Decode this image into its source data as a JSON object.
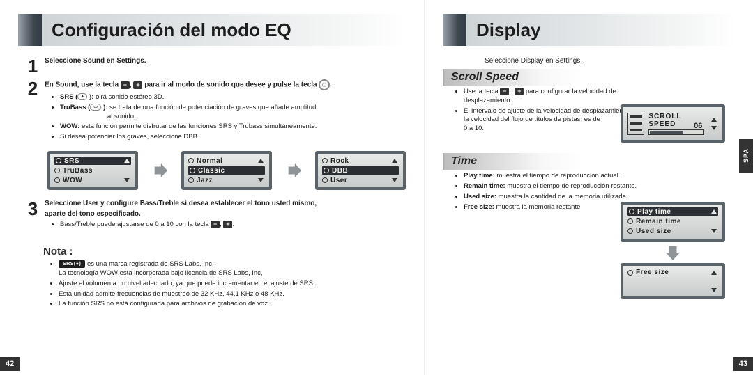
{
  "left": {
    "title": "Configuración del modo EQ",
    "page_number": "42",
    "step1": {
      "num": "1",
      "head": "Seleccione Sound en Settings."
    },
    "step2": {
      "num": "2",
      "head_a": "En Sound, use la tecla",
      "head_b": "para ir al modo de sonido que desee y pulse la tecla",
      "b1a": "SRS (",
      "b1b": "):",
      "b1c": " oirá sonido estéreo 3D.",
      "b2a": "TruBass (",
      "b2b": "):",
      "b2c": " se trata de una función de potenciación de graves que añade amplitud",
      "b2d": "al sonido.",
      "b3a": "WOW:",
      "b3b": " esta función permite disfrutar de las funciones SRS y Trubass simultáneamente.",
      "b4": "Si desea potenciar los graves, seleccione DBB."
    },
    "lcd": {
      "a": {
        "r1": "SRS",
        "r2": "TruBass",
        "r3": "WOW"
      },
      "b": {
        "r1": "Normal",
        "r2": "Classic",
        "r3": "Jazz"
      },
      "c": {
        "r1": "Rock",
        "r2": "DBB",
        "r3": "User"
      }
    },
    "step3": {
      "num": "3",
      "head1": "Seleccione User y configure Bass/Treble si desea establecer el tono usted mismo,",
      "head2": "aparte del tono especificado.",
      "b1": "Bass/Treble puede ajustarse de 0 a 10 con la tecla"
    },
    "nota": {
      "title": "Nota :",
      "b1a": " es una marca registrada de SRS Labs, Inc.",
      "b1b": "La tecnología WOW esta incorporada bajo licencia de SRS Labs, Inc,",
      "b2": "Ajuste el volumen a un nivel adecuado, ya que puede incrementar en el ajuste de SRS.",
      "b3": "Esta unidad admite frecuencias de muestreo de 32 KHz, 44,1 KHz o 48 KHz.",
      "b4": "La función SRS no está configurada para archivos de grabación de voz."
    }
  },
  "right": {
    "title": "Display",
    "page_number": "43",
    "spa": "SPA",
    "intro": "Seleccione Display en Settings.",
    "scroll": {
      "title": "Scroll Speed",
      "b1": "Use la tecla",
      "b1b": "para configurar la velocidad de desplazamiento.",
      "b2a": "El intervalo de ajuste de la velocidad de desplazamiento, que ajusta la velocidad del flujo de títulos de pistas, es de",
      "b2b": "0 a 10.",
      "lcd_label": "SCROLL SPEED",
      "lcd_value": "06",
      "icon_caption": "SCROLL SPEED"
    },
    "time": {
      "title": "Time",
      "b1a": "Play time:",
      "b1b": " muestra el tiempo de reproducción actual.",
      "b2a": "Remain time:",
      "b2b": " muestra el tiempo de reproducción restante.",
      "b3a": "Used size:",
      "b3b": " muestra la cantidad de la memoria utilizada.",
      "b4a": "Free size:",
      "b4b": " muestra la memoria restante",
      "lcd": {
        "r1": "Play time",
        "r2": "Remain time",
        "r3": "Used size",
        "r4": "Free size"
      }
    }
  },
  "icons": {
    "minus": "−",
    "plus": "+",
    "srs_logo": "SRS(●)"
  }
}
